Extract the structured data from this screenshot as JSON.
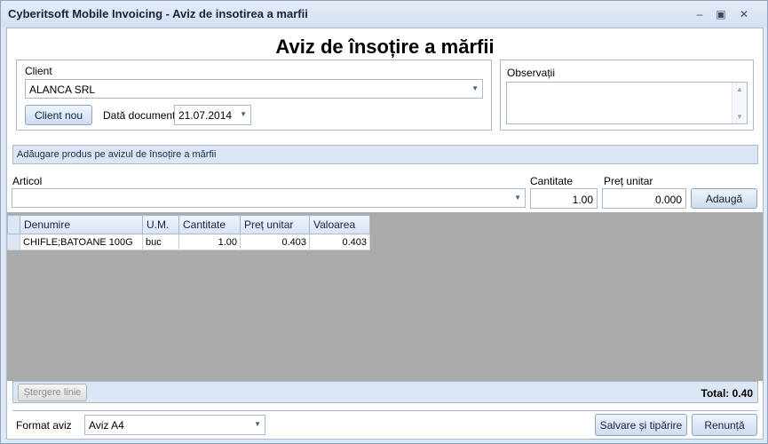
{
  "window": {
    "title": "Cyberitsoft Mobile Invoicing - Aviz de insotirea a marfii",
    "minimize_icon": "minimize-icon",
    "maximize_icon": "maximize-icon",
    "close_icon": "close-icon"
  },
  "header": {
    "title": "Aviz de însoțire a mărfii"
  },
  "client": {
    "label": "Client",
    "selected": "ALANCA SRL",
    "new_button": "Client nou",
    "doc_date_label": "Dată document",
    "doc_date": "21.07.2014"
  },
  "observations": {
    "label": "Observații",
    "value": ""
  },
  "add_section": {
    "title": "Adăugare produs pe avizul de însoțire a mărfii",
    "article_label": "Articol",
    "article_value": "",
    "quantity_label": "Cantitate",
    "quantity_value": "1.00",
    "unit_price_label": "Preț unitar",
    "unit_price_value": "0.000",
    "add_button": "Adaugă"
  },
  "grid": {
    "columns": [
      "Denumire",
      "U.M.",
      "Cantitate",
      "Preț unitar",
      "Valoarea"
    ],
    "rows": [
      [
        "CHIFLE;BATOANE 100G",
        "buc",
        "1.00",
        "0.403",
        "0.403"
      ]
    ]
  },
  "footer": {
    "delete_button": "Ștergere linie",
    "total_label": "Total: 0.40",
    "format_label": "Format aviz",
    "format_value": "Aviz A4",
    "save_print_button": "Salvare și tipărire",
    "cancel_button": "Renunță"
  }
}
